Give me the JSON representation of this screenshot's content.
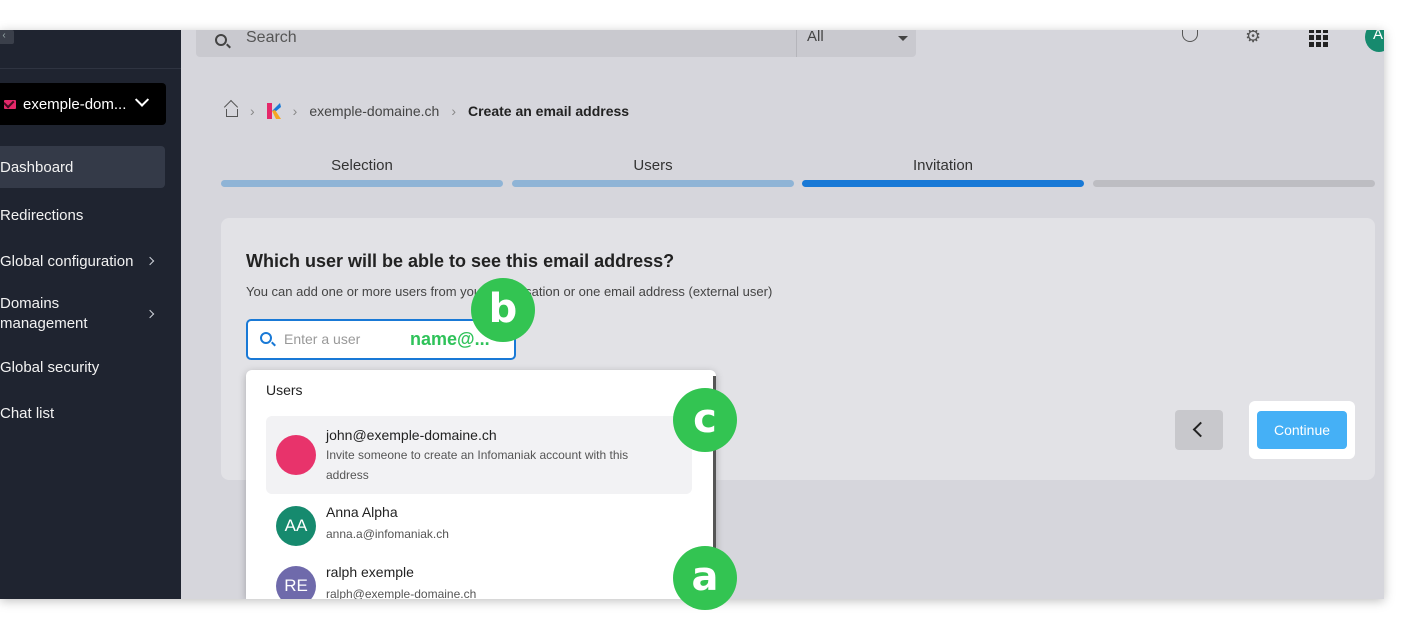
{
  "sidebar": {
    "domain_label": "exemple-dom...",
    "items": [
      {
        "label": "Dashboard"
      },
      {
        "label": "Redirections"
      },
      {
        "label": "Global configuration"
      },
      {
        "label": "Domains management"
      },
      {
        "label": "Global security"
      },
      {
        "label": "Chat list"
      }
    ]
  },
  "topbar": {
    "search_placeholder": "Search",
    "scope_value": "All",
    "avatar_initial": "A"
  },
  "breadcrumb": {
    "domain": "exemple-domaine.ch",
    "current": "Create an email address"
  },
  "steps": [
    {
      "label": "Selection",
      "status": "done"
    },
    {
      "label": "Users",
      "status": "done"
    },
    {
      "label": "Invitation",
      "status": "current"
    },
    {
      "label": "",
      "status": "todo"
    }
  ],
  "card": {
    "title": "Which user will be able to see this email address?",
    "subtitle": "You can add one or more users from your organisation or one email address (external user)",
    "input_placeholder": "Enter a user",
    "typed_hint": "name@..."
  },
  "buttons": {
    "continue": "Continue"
  },
  "dropdown": {
    "header": "Users",
    "items": [
      {
        "initials": "",
        "name": "john@exemple-domaine.ch",
        "desc": "Invite someone to create an Infomaniak account with this address",
        "color": "#e8336b"
      },
      {
        "initials": "AA",
        "name": "Anna Alpha",
        "desc": "anna.a@infomaniak.ch",
        "color": "#168a6e"
      },
      {
        "initials": "RE",
        "name": "ralph exemple",
        "desc": "ralph@exemple-domaine.ch",
        "color": "#6f6aab"
      }
    ]
  },
  "markers": {
    "a": "a",
    "b": "b",
    "c": "c"
  },
  "colors": {
    "accent": "#1979d6",
    "continue": "#45b0f6",
    "marker": "#33c452",
    "sidebar": "#1f2430"
  }
}
